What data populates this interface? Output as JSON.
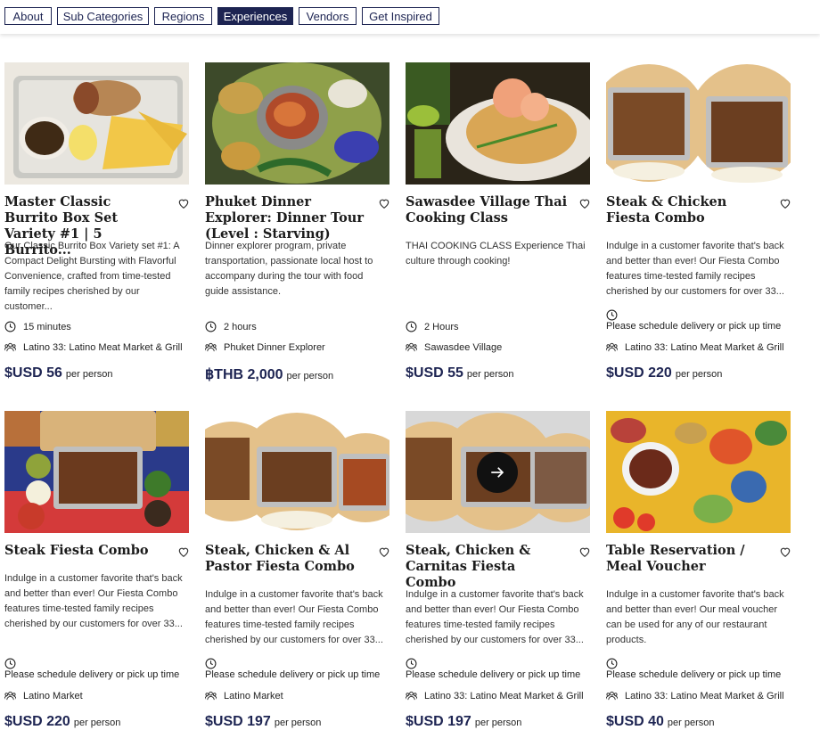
{
  "nav": {
    "tabs": [
      {
        "label": "About",
        "active": false
      },
      {
        "label": "Sub Categories",
        "active": false
      },
      {
        "label": "Regions",
        "active": false
      },
      {
        "label": "Experiences",
        "active": true
      },
      {
        "label": "Vendors",
        "active": false
      },
      {
        "label": "Get Inspired",
        "active": false
      }
    ]
  },
  "cards": [
    {
      "title": "Master Classic Burrito Box Set Variety #1 | 5 Burrito...",
      "description": "Our Classic Burrito Box Variety set #1: A Compact Delight Bursting with Flavorful Convenience, crafted from time-tested family recipes cherished by our customer...",
      "duration": "15 minutes",
      "vendor": "Latino 33: Latino Meat Market & Grill",
      "price": "$USD 56",
      "per": "per person",
      "image_icon": "burrito-photo"
    },
    {
      "title": "Phuket Dinner Explorer: Dinner Tour (Level : Starving)",
      "description": "Dinner explorer program, private transportation, passionate local host to accompany during the tour with food guide assistance.",
      "duration": "2 hours",
      "vendor": "Phuket Dinner Explorer",
      "price": "฿THB 2,000",
      "per": "per person",
      "image_icon": "thai-salad-photo"
    },
    {
      "title": "Sawasdee Village Thai Cooking Class",
      "description": "THAI COOKING CLASS Experience Thai culture through cooking!",
      "duration": "2 Hours",
      "vendor": "Sawasdee Village",
      "price": "$USD 55",
      "per": "per person",
      "image_icon": "pad-thai-photo"
    },
    {
      "title": "Steak & Chicken Fiesta Combo",
      "description": "Indulge in a customer favorite that's back and better than ever! Our Fiesta Combo features time-tested family recipes cherished by our customers for over 33...",
      "duration": "Please schedule delivery or pick up time",
      "vendor": "Latino 33: Latino Meat Market & Grill",
      "price": "$USD 220",
      "per": "per person",
      "image_icon": "fiesta-trays-photo"
    },
    {
      "title": "Steak Fiesta Combo",
      "description": "Indulge in a customer favorite that's back and better than ever! Our Fiesta Combo features time-tested family recipes cherished by our customers for over 33...",
      "duration": "Please schedule delivery or pick up time",
      "vendor": "Latino Market",
      "price": "$USD 220",
      "per": "per person",
      "image_icon": "steak-fiesta-photo"
    },
    {
      "title": "Steak, Chicken & Al Pastor Fiesta Combo",
      "description": "Indulge in a customer favorite that's back and better than ever! Our Fiesta Combo features time-tested family recipes cherished by our customers for over 33...",
      "duration": "Please schedule delivery or pick up time",
      "vendor": "Latino Market",
      "price": "$USD 197",
      "per": "per person",
      "image_icon": "al-pastor-trays-photo"
    },
    {
      "title": "Steak, Chicken & Carnitas Fiesta Combo",
      "description": "Indulge in a customer favorite that's back and better than ever! Our Fiesta Combo features time-tested family recipes cherished by our customers for over 33...",
      "duration": "Please schedule delivery or pick up time",
      "vendor": "Latino 33: Latino Meat Market & Grill",
      "price": "$USD 197",
      "per": "per person",
      "image_icon": "carnitas-trays-photo"
    },
    {
      "title": "Table Reservation / Meal Voucher",
      "description": "Indulge in a customer favorite that's back and better than ever! Our meal voucher can be used for any of our restaurant products.",
      "duration": "Please schedule delivery or pick up time",
      "vendor": "Latino 33: Latino Meat Market & Grill",
      "price": "$USD 40",
      "per": "per person",
      "image_icon": "table-spread-photo"
    }
  ],
  "colors": {
    "accent": "#1d2452",
    "text": "#1c1c1c"
  }
}
